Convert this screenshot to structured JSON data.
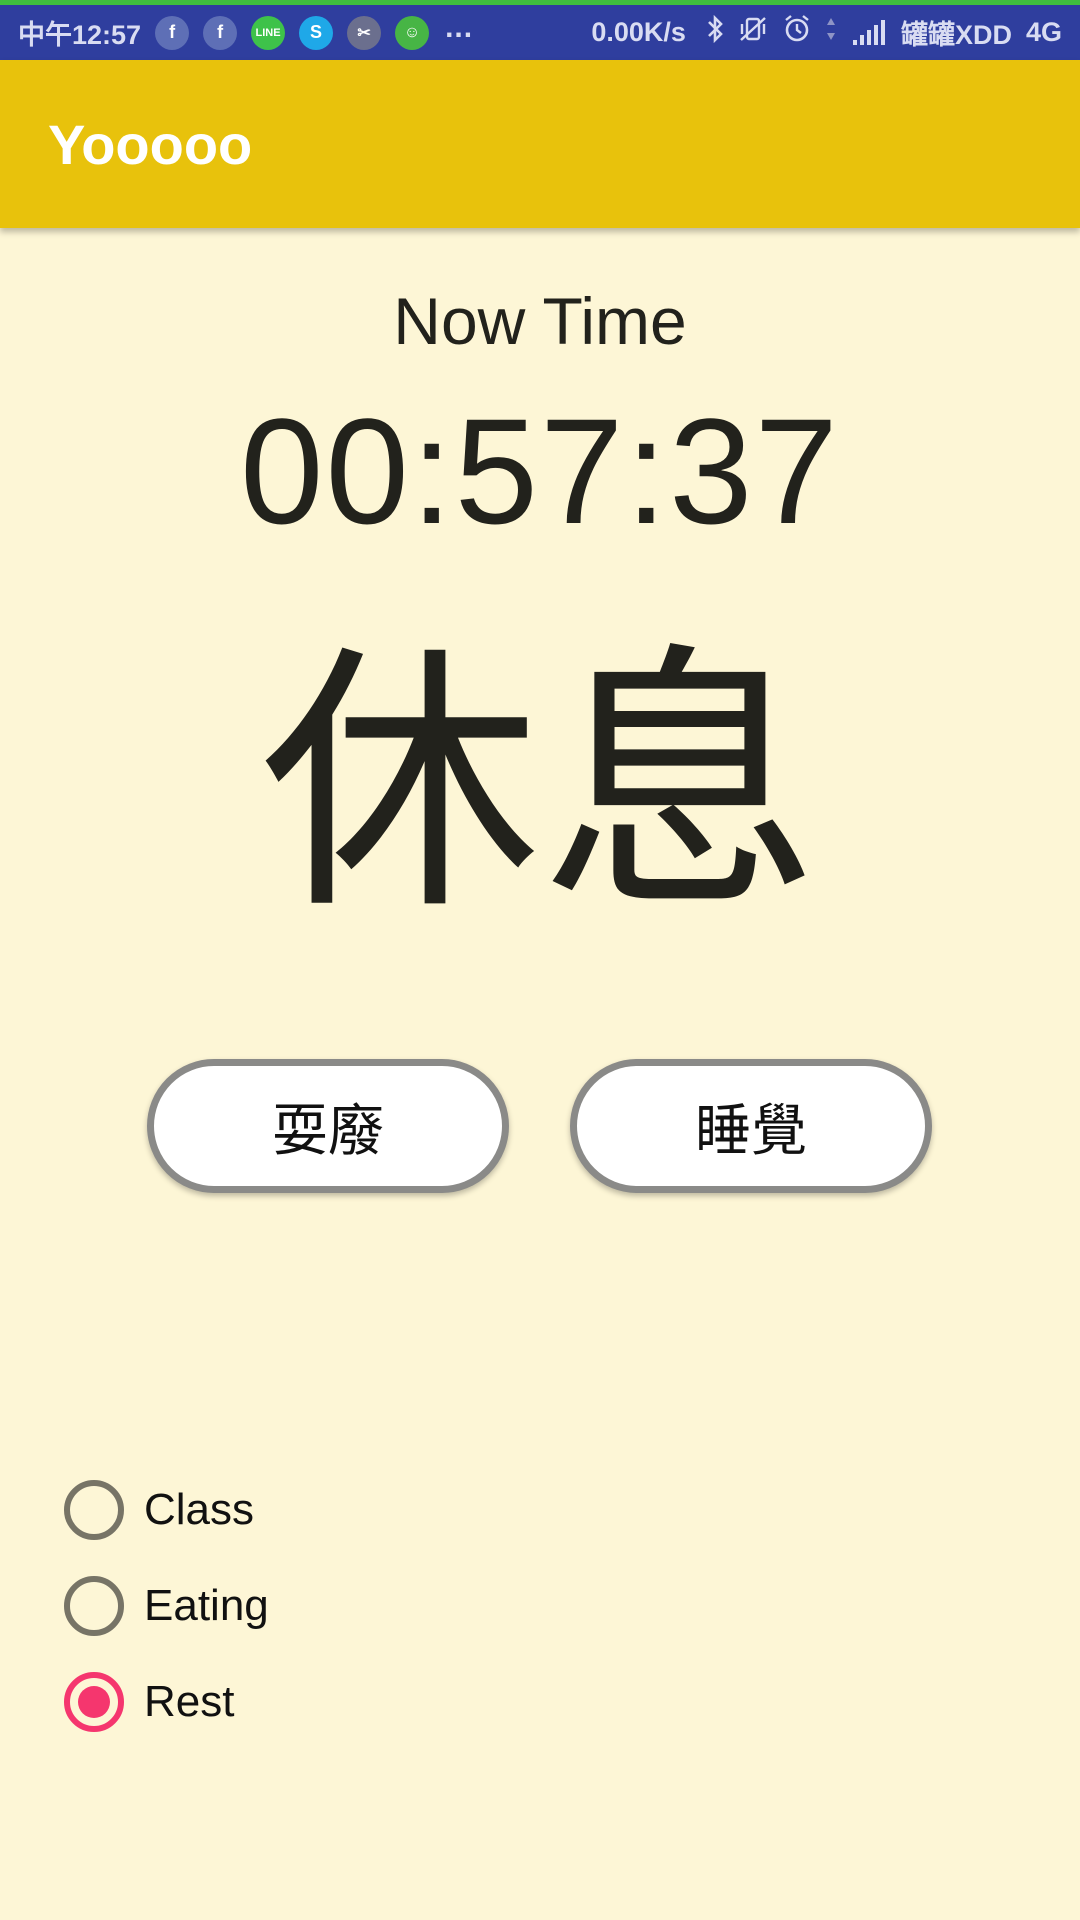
{
  "status_bar": {
    "time": "中午12:57",
    "notification_icons": [
      {
        "name": "facebook",
        "glyph": "f"
      },
      {
        "name": "facebook",
        "glyph": "f"
      },
      {
        "name": "line",
        "glyph": "LINE"
      },
      {
        "name": "skype",
        "glyph": "S"
      },
      {
        "name": "scissors",
        "glyph": "✂"
      },
      {
        "name": "frog",
        "glyph": "☺"
      }
    ],
    "more": "...",
    "net_speed": "0.00K/s",
    "carrier": "罐罐XDD",
    "network": "4G"
  },
  "app_bar": {
    "title": "Yooooo",
    "color": "#E8C20C"
  },
  "main": {
    "label": "Now Time",
    "clock": "00:57:37",
    "status": "休息"
  },
  "buttons": {
    "left_label": "耍廢",
    "right_label": "睡覺"
  },
  "radio_group": {
    "options": [
      {
        "label": "Class",
        "checked": false
      },
      {
        "label": "Eating",
        "checked": false
      },
      {
        "label": "Rest",
        "checked": true
      }
    ],
    "accent": "#F5366E"
  },
  "colors": {
    "background": "#FDF6D6",
    "status_bar": "#2F3E9E"
  }
}
